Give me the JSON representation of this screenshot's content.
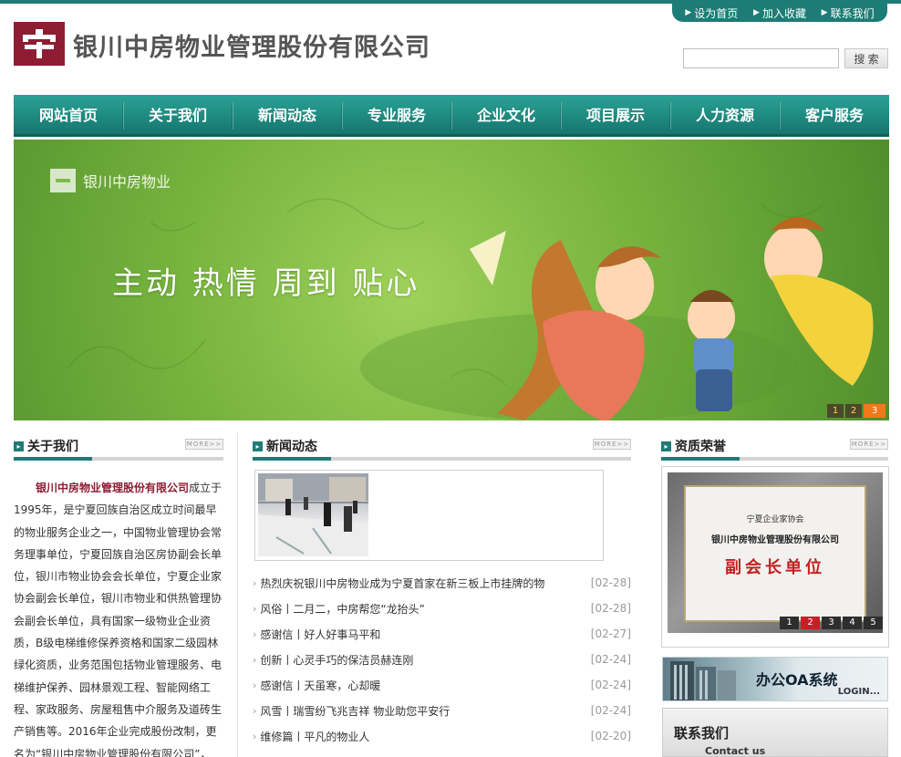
{
  "toplinks": [
    {
      "label": "设为首页"
    },
    {
      "label": "加入收藏"
    },
    {
      "label": "联系我们"
    }
  ],
  "header": {
    "company_name": "银川中房物业管理股份有限公司",
    "search_button": "搜 索",
    "search_value": ""
  },
  "nav": [
    {
      "label": "网站首页"
    },
    {
      "label": "关于我们"
    },
    {
      "label": "新闻动态"
    },
    {
      "label": "专业服务"
    },
    {
      "label": "企业文化"
    },
    {
      "label": "项目展示"
    },
    {
      "label": "人力资源"
    },
    {
      "label": "客户服务"
    }
  ],
  "banner": {
    "brand": "银川中房物业",
    "slogan": "主动  热情  周到  贴心",
    "pages": [
      "1",
      "2",
      "3"
    ],
    "active_page": 3
  },
  "about": {
    "title": "关于我们",
    "more": "MORE>>",
    "company": "银川中房物业管理股份有限公司",
    "body": "成立于1995年，是宁夏回族自治区成立时间最早的物业服务企业之一，中国物业管理协会常务理事单位，宁夏回族自治区房协副会长单位，银川市物业协会会长单位，宁夏企业家协会副会长单位，银川市物业和供热管理协会副会长单位，具有国家一级物业企业资质，B级电梯维修保养资格和国家二级园林绿化资质，业务范围包括物业管理服务、电梯维护保养、园林景观工程、智能网络工程、家政服务、房屋租售中介服务及道砖生产销售等。2016年企业完成股份改制，更名为“银川中房物业管理股份有限公司”，"
  },
  "news": {
    "title": "新闻动态",
    "more": "MORE>>",
    "items": [
      {
        "title": "热烈庆祝银川中房物业成为宁夏首家在新三板上市挂牌的物",
        "date": "[02-28]"
      },
      {
        "title": "风俗丨二月二，中房帮您“龙抬头”",
        "date": "[02-28]"
      },
      {
        "title": "感谢信丨好人好事马平和",
        "date": "[02-27]"
      },
      {
        "title": "创新丨心灵手巧的保洁员赫连刚",
        "date": "[02-24]"
      },
      {
        "title": "感谢信丨天虽寒，心却暖",
        "date": "[02-24]"
      },
      {
        "title": "风雪丨瑞雪纷飞兆吉祥 物业助您平安行",
        "date": "[02-24]"
      },
      {
        "title": "维修篇丨平凡的物业人",
        "date": "[02-20]"
      }
    ]
  },
  "honors": {
    "title": "资质荣誉",
    "more": "MORE>>",
    "certificate": {
      "org": "宁夏企业家协会",
      "name": "银川中房物业管理股份有限公司",
      "award": "副会长单位"
    },
    "pages": [
      "1",
      "2",
      "3",
      "4",
      "5"
    ],
    "active_page": 2
  },
  "oa": {
    "label": "办公OA系统",
    "login": "LOGIN..."
  },
  "contact": {
    "label_cn": "联系我们",
    "label_en": "Contact us"
  },
  "colors": {
    "brand_teal": "#1d7c76",
    "brand_maroon": "#8e1d33",
    "banner_green": "#77b43e"
  }
}
